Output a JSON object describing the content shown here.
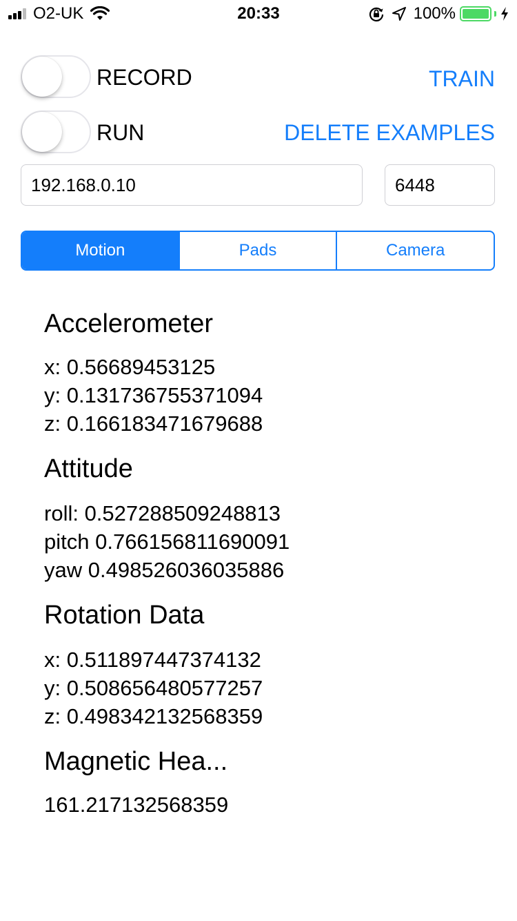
{
  "status_bar": {
    "carrier": "O2-UK",
    "time": "20:33",
    "battery_percent": "100%",
    "battery_level": 1.0,
    "battery_color": "#4cd964",
    "icons": [
      "signal-icon",
      "wifi-icon",
      "rotation-lock-icon",
      "location-icon",
      "battery-icon",
      "charging-icon"
    ]
  },
  "controls": {
    "record_label": "RECORD",
    "run_label": "RUN",
    "record_on": false,
    "run_on": false,
    "train_label": "TRAIN",
    "delete_label": "DELETE EXAMPLES"
  },
  "connection": {
    "ip": "192.168.0.10",
    "port": "6448"
  },
  "tabs": [
    {
      "label": "Motion",
      "active": true
    },
    {
      "label": "Pads",
      "active": false
    },
    {
      "label": "Camera",
      "active": false
    }
  ],
  "accent_color": "#147efb",
  "sensors": {
    "accelerometer": {
      "title": "Accelerometer",
      "x": "x: 0.56689453125",
      "y": "y: 0.131736755371094",
      "z": "z: 0.166183471679688"
    },
    "attitude": {
      "title": "Attitude",
      "roll": "roll: 0.527288509248813",
      "pitch": "pitch 0.766156811690091",
      "yaw": "yaw 0.498526036035886"
    },
    "rotation": {
      "title": "Rotation Data",
      "x": "x: 0.511897447374132",
      "y": "y: 0.508656480577257",
      "z": "z: 0.498342132568359"
    },
    "magnetic": {
      "title": "Magnetic Hea...",
      "value": "161.217132568359"
    }
  }
}
